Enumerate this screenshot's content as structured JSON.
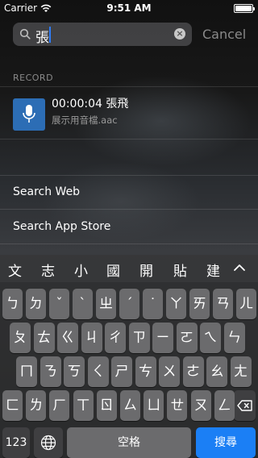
{
  "status": {
    "carrier": "Carrier",
    "time": "9:51 AM"
  },
  "search": {
    "query": "張",
    "cancel": "Cancel"
  },
  "section_header": "RECORD",
  "result": {
    "title": "00:00:04  張飛",
    "subtitle": "展示用音檔.aac"
  },
  "rows": [
    "Search Web",
    "Search App Store"
  ],
  "keyboard": {
    "candidates": [
      "文",
      "志",
      "小",
      "國",
      "開",
      "貼",
      "建"
    ],
    "row1": [
      "ㄅ",
      "ㄉ",
      "ˇ",
      "ˋ",
      "ㄓ",
      "ˊ",
      "˙",
      "ㄚ",
      "ㄞ",
      "ㄢ",
      "ㄦ"
    ],
    "row2": [
      "ㄆ",
      "ㄊ",
      "ㄍ",
      "ㄐ",
      "ㄔ",
      "ㄗ",
      "ㄧ",
      "ㄛ",
      "ㄟ",
      "ㄣ"
    ],
    "row3": [
      "ㄇ",
      "ㄋ",
      "ㄎ",
      "ㄑ",
      "ㄕ",
      "ㄘ",
      "ㄨ",
      "ㄜ",
      "ㄠ",
      "ㄤ"
    ],
    "row4": [
      "ㄈ",
      "ㄌ",
      "ㄏ",
      "ㄒ",
      "ㄖ",
      "ㄙ",
      "ㄩ",
      "ㄝ",
      "ㄡ",
      "ㄥ"
    ],
    "numbers_label": "123",
    "space_label": "空格",
    "search_label": "搜尋"
  },
  "colors": {
    "accent": "#1b7ff5",
    "app_icon": "#2c6db5"
  }
}
